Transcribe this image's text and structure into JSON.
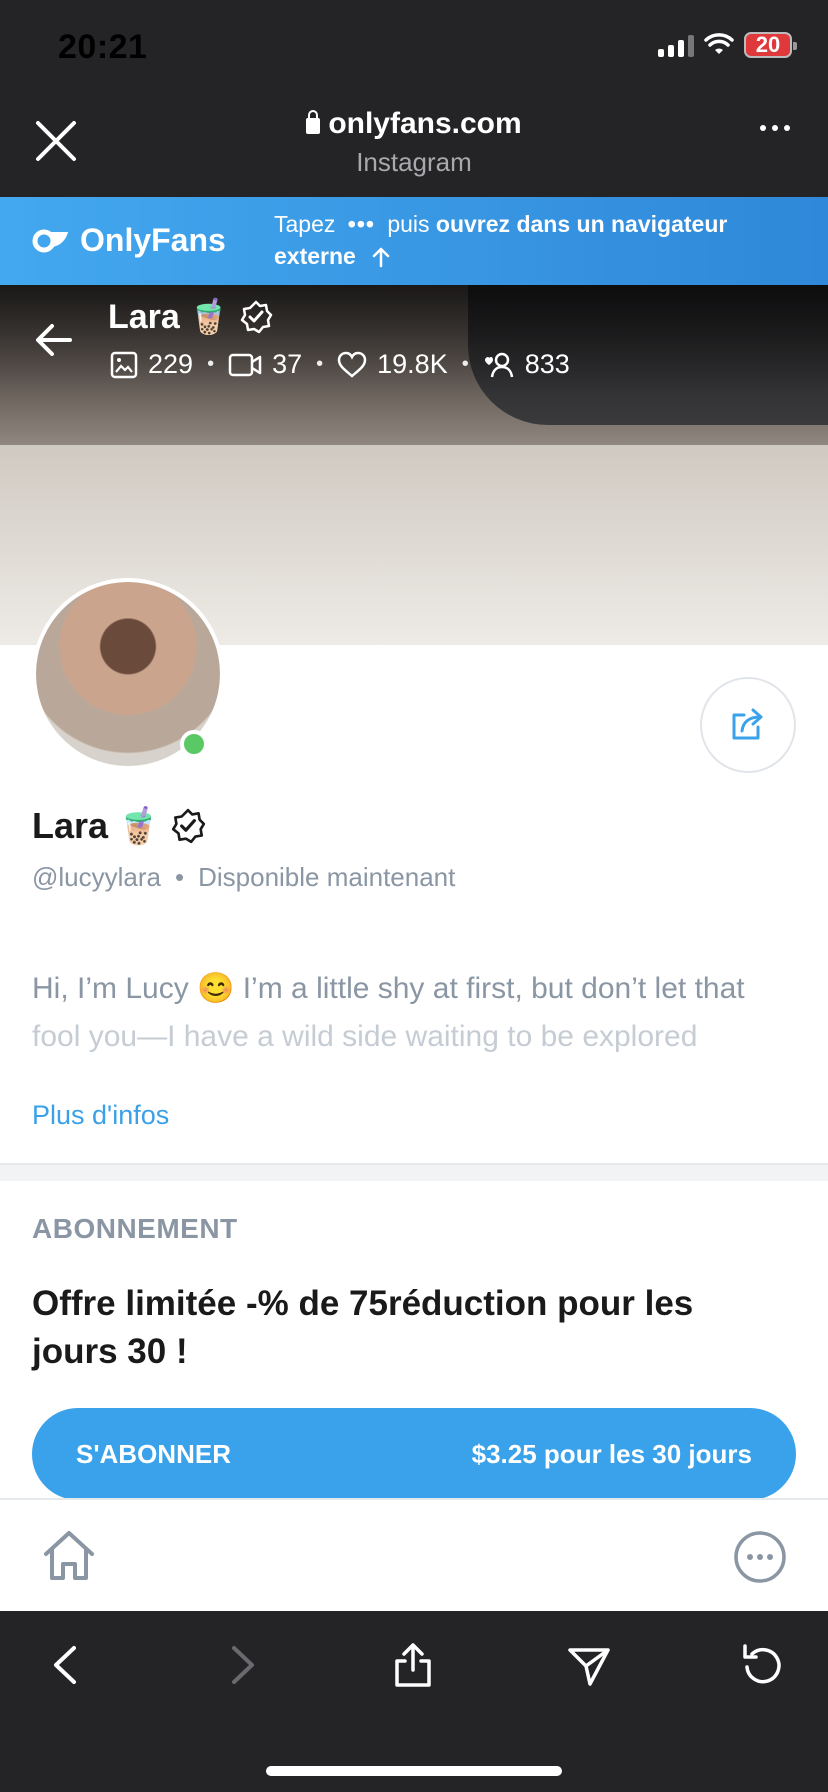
{
  "status_bar": {
    "time": "20:21",
    "battery": "20"
  },
  "browser": {
    "url": "onlyfans.com",
    "subtitle": "Instagram"
  },
  "banner": {
    "logo_text": "OnlyFans",
    "text_prefix": "Tapez",
    "text_middle": "puis",
    "text_bold": "ouvrez dans un navigateur externe"
  },
  "cover": {
    "name": "Lara",
    "emoji": "🧋",
    "stats": {
      "photos": "229",
      "videos": "37",
      "likes": "19.8K",
      "fans": "833"
    }
  },
  "profile": {
    "name": "Lara",
    "emoji": "🧋",
    "handle": "@lucyylara",
    "separator": "•",
    "availability": "Disponible maintenant",
    "bio_line1": "Hi, I’m Lucy 😊 I’m a little shy at first, but don’t let that",
    "bio_line2": "fool you—I have a wild side waiting to be explored",
    "more_info": "Plus d'infos"
  },
  "subscription": {
    "heading": "ABONNEMENT",
    "offer": "Offre limitée -% de 75réduction pour les jours 30 !",
    "button_label": "S'ABONNER",
    "button_price": "$3.25 pour les 30 jours"
  },
  "colors": {
    "accent": "#3aa2ea",
    "online": "#5ac864",
    "dark_bar": "#242426"
  }
}
